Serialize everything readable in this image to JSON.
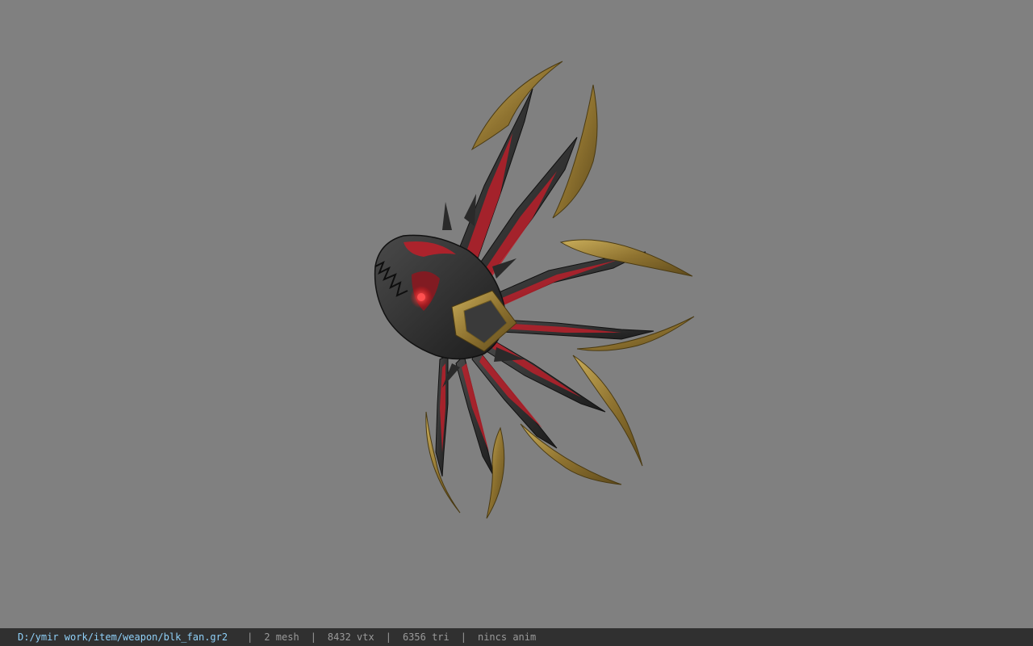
{
  "viewport": {
    "background": "#808080",
    "model_description": "blk_fan weapon model"
  },
  "statusbar": {
    "file_path": "D:/ymir work/item/weapon/blk_fan.gr2",
    "separator": "|",
    "mesh_count": "2 mesh",
    "vertex_count": "8432 vtx",
    "triangle_count": "6356 tri",
    "anim_status": "nincs anim"
  },
  "colors": {
    "path_text": "#8fd0f8",
    "stat_text": "#9a9a9a",
    "statusbar_bg": "#303030",
    "gold": "#a88a3a",
    "red_inlay": "#b8202a",
    "dark_metal": "#2a2a2a"
  }
}
